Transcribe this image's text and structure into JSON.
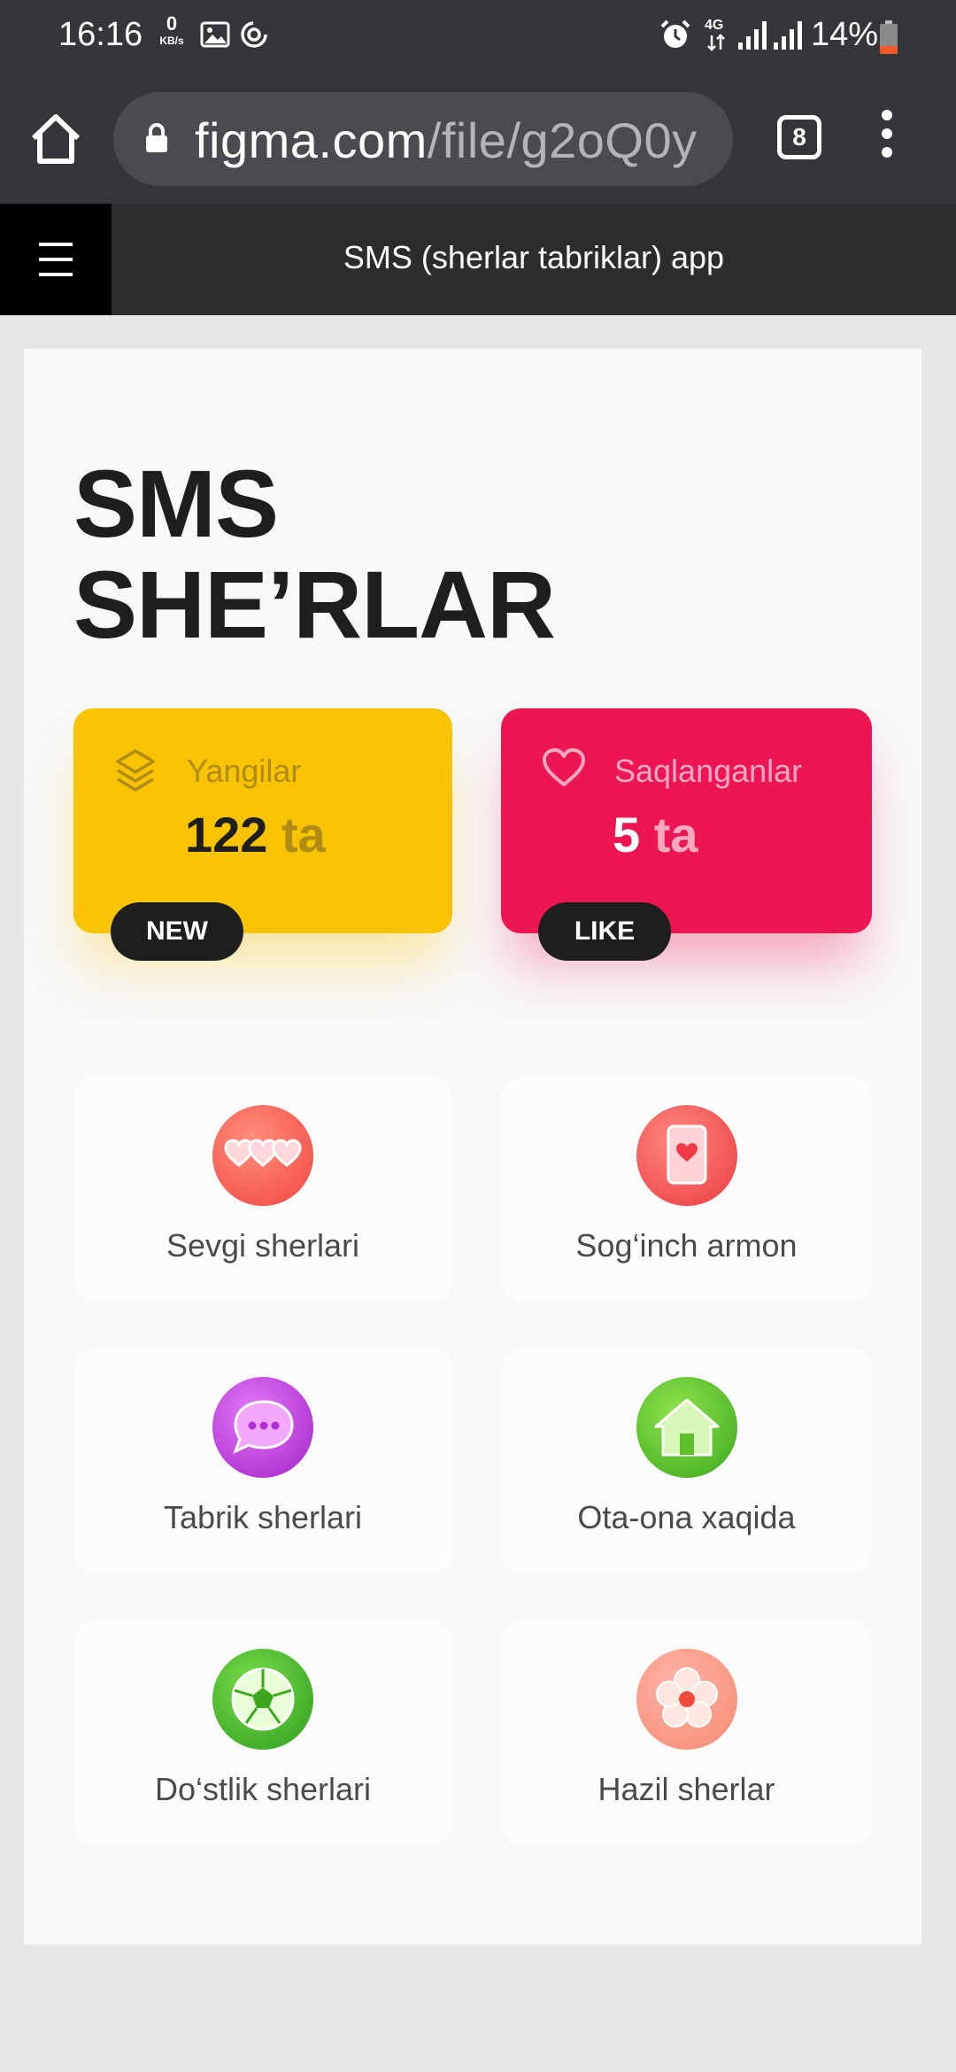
{
  "status_bar": {
    "time": "16:16",
    "net_speed_value": "0",
    "net_speed_unit": "KB/s",
    "network_type": "4G",
    "battery": "14%",
    "icons": [
      "gallery-icon",
      "sync-icon",
      "alarm-icon",
      "signal-icon",
      "signal-icon",
      "battery-icon"
    ]
  },
  "browser": {
    "url_domain": "figma.com",
    "url_path": "/file/g2oQ0y",
    "tab_count": "8"
  },
  "figma": {
    "title": "SMS (sherlar tabriklar) app"
  },
  "app": {
    "title_line1": "SMS",
    "title_line2": "SHE’RLAR",
    "new_card": {
      "label": "Yangilar",
      "count": "122",
      "unit": "ta",
      "badge": "NEW",
      "color": "#f8c300"
    },
    "like_card": {
      "label": "Saqlanganlar",
      "count": "5",
      "unit": "ta",
      "badge": "LIKE",
      "color": "#ec1654"
    },
    "categories": [
      {
        "label": "Sevgi sherlari",
        "icon": "hearts-icon"
      },
      {
        "label": "Sog‘inch armon",
        "icon": "love-card-icon"
      },
      {
        "label": "Tabrik sherlari",
        "icon": "chat-bubble-icon"
      },
      {
        "label": "Ota-ona xaqida",
        "icon": "house-icon"
      },
      {
        "label": "Do‘stlik sherlari",
        "icon": "soccer-ball-icon"
      },
      {
        "label": "Hazil sherlar",
        "icon": "flower-icon"
      }
    ]
  }
}
